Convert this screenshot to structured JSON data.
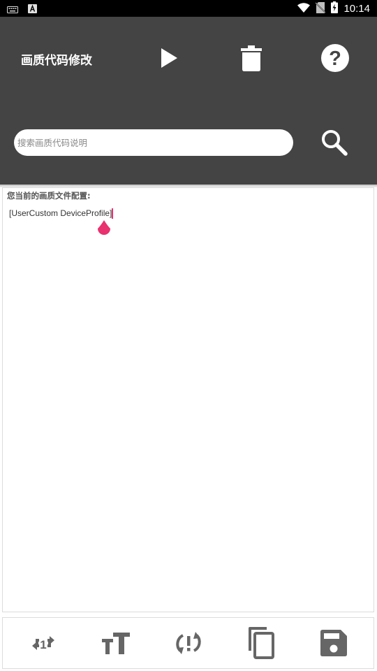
{
  "status_bar": {
    "time": "10:14",
    "icons": [
      "keyboard-icon",
      "a-notification-icon",
      "wifi-icon",
      "no-sim-icon",
      "battery-charging-icon"
    ]
  },
  "header": {
    "title": "画质代码修改",
    "buttons": [
      "play-icon",
      "trash-icon",
      "help-icon"
    ],
    "background": "#444444"
  },
  "search": {
    "placeholder": "搜索画质代码说明",
    "value": "",
    "button_icon": "search-icon"
  },
  "editor": {
    "label": "您当前的画质文件配置:",
    "content": "[UserCustom DeviceProfile]",
    "cursor_color": "#e8316e"
  },
  "bottom_toolbar": {
    "buttons": [
      "repeat-one-icon",
      "text-size-icon",
      "sync-problem-icon",
      "copy-icon",
      "save-icon"
    ],
    "icon_color": "#666666"
  }
}
